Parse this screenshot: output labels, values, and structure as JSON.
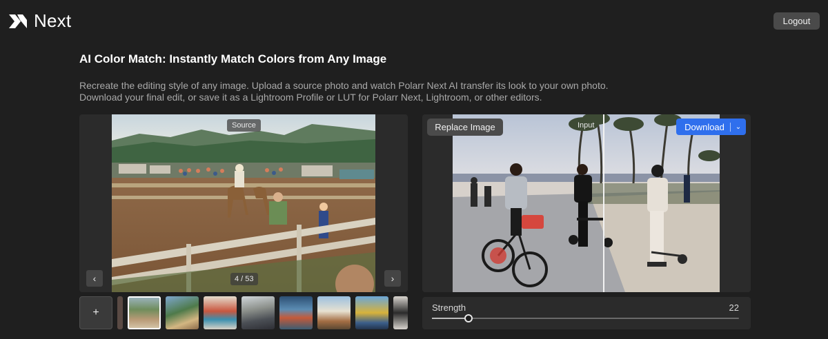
{
  "header": {
    "logo_text": "Next",
    "logout_label": "Logout"
  },
  "main": {
    "title": "AI Color Match: Instantly Match Colors from Any Image",
    "description_line1": "Recreate the editing style of any image. Upload a source photo and watch Polarr Next AI transfer its look to your own photo.",
    "description_line2": "Download your final edit, or save it as a Lightroom Profile or LUT for Polarr Next, Lightroom, or other editors."
  },
  "source_panel": {
    "tag": "Source",
    "counter": "4 / 53",
    "prev_icon": "‹",
    "next_icon": "›"
  },
  "input_panel": {
    "tag": "Input",
    "replace_label": "Replace Image",
    "download_label": "Download",
    "download_caret": "⌄"
  },
  "thumbnails": {
    "add_label": "+",
    "count_visible": 9
  },
  "strength": {
    "label": "Strength",
    "value": "22",
    "fraction": 0.12
  },
  "colors": {
    "accent": "#2f6fed",
    "background": "#1f1f1f",
    "panel": "#2b2b2b"
  }
}
